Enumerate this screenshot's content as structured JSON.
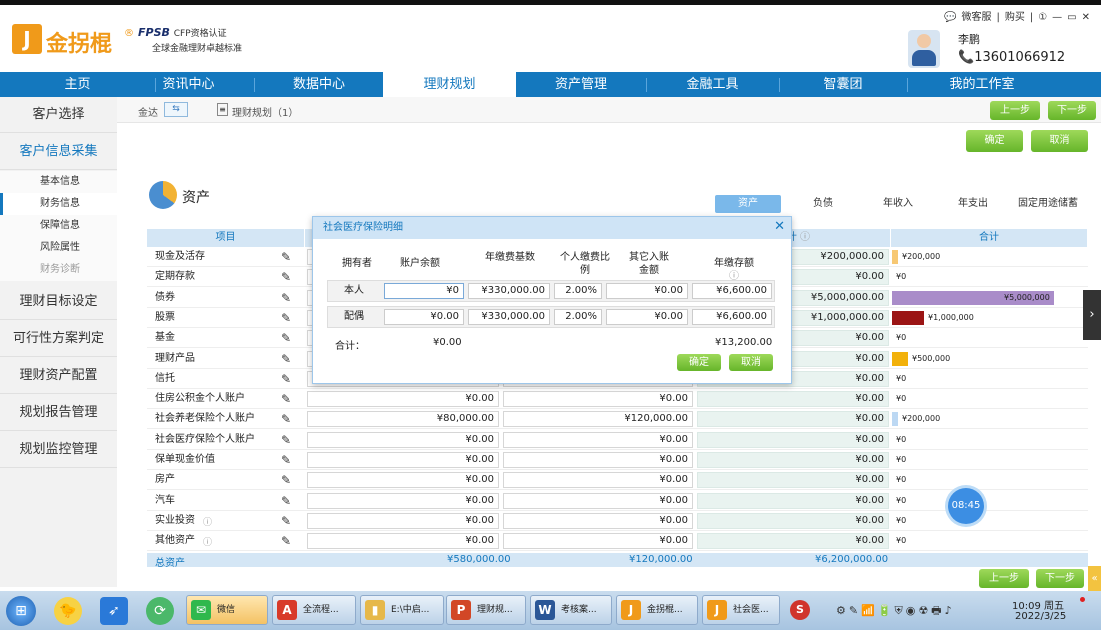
{
  "app": {
    "logo_text": "金拐棍",
    "logo_mark": "J",
    "logo_reg": "®",
    "fpsb_line1": "FPSB",
    "fpsb_sup": "CFP资格认证",
    "fpsb_line2": "全球金融理财卓越标准"
  },
  "window_controls": [
    "微客服",
    "购买",
    "①",
    "—",
    "▭",
    "✕"
  ],
  "user": {
    "name": "李鹏",
    "phone": "13601066912"
  },
  "nav": [
    "主页",
    "资讯中心",
    "数据中心",
    "理财规划",
    "资产管理",
    "金融工具",
    "智囊团",
    "我的工作室"
  ],
  "nav_active": "理财规划",
  "sidebar": {
    "main1": "客户选择",
    "main2": "客户信息采集",
    "subs": [
      "基本信息",
      "财务信息",
      "保障信息",
      "风险属性",
      "财务诊断"
    ],
    "mains": [
      "理财目标设定",
      "可行性方案判定",
      "理财资产配置",
      "规划报告管理",
      "规划监控管理"
    ]
  },
  "crumbs": {
    "client": "金达",
    "plan": "理财规划（1）"
  },
  "buttons": {
    "prev": "上一步",
    "next": "下一步",
    "confirm": "确定",
    "cancel": "取消"
  },
  "section_title": "资产",
  "tabs": [
    "资产",
    "负债",
    "年收入",
    "年支出",
    "固定用途储蓄"
  ],
  "table": {
    "headers": {
      "item": "项目",
      "col4": "计",
      "total": "合计"
    },
    "rows": [
      {
        "name": "现金及活存",
        "c1": "",
        "c2": "",
        "c3": "¥200,000.00",
        "bar_label": "¥200,000"
      },
      {
        "name": "定期存款",
        "c1": "",
        "c2": "",
        "c3": "¥0.00",
        "bar_label": "¥0"
      },
      {
        "name": "债券",
        "c1": "",
        "c2": "",
        "c3": "¥5,000,000.00",
        "bar_label": "¥5,000,000"
      },
      {
        "name": "股票",
        "c1": "",
        "c2": "",
        "c3": "¥1,000,000.00",
        "bar_label": "¥1,000,000"
      },
      {
        "name": "基金",
        "c1": "",
        "c2": "",
        "c3": "¥0.00",
        "bar_label": "¥0"
      },
      {
        "name": "理财产品",
        "c1": "",
        "c2": "",
        "c3": "¥0.00",
        "bar_label": "¥500,000"
      },
      {
        "name": "信托",
        "c1": "",
        "c2": "",
        "c3": "¥0.00",
        "bar_label": "¥0"
      },
      {
        "name": "住房公积金个人账户",
        "c1": "¥0.00",
        "c2": "¥0.00",
        "c3": "¥0.00",
        "bar_label": "¥0"
      },
      {
        "name": "社会养老保险个人账户",
        "c1": "¥80,000.00",
        "c2": "¥120,000.00",
        "c3": "¥0.00",
        "bar_label": "¥200,000"
      },
      {
        "name": "社会医疗保险个人账户",
        "c1": "¥0.00",
        "c2": "¥0.00",
        "c3": "¥0.00",
        "bar_label": "¥0"
      },
      {
        "name": "保单现金价值",
        "c1": "¥0.00",
        "c2": "¥0.00",
        "c3": "¥0.00",
        "bar_label": "¥0"
      },
      {
        "name": "房产",
        "c1": "¥0.00",
        "c2": "¥0.00",
        "c3": "¥0.00",
        "bar_label": "¥0"
      },
      {
        "name": "汽车",
        "c1": "¥0.00",
        "c2": "¥0.00",
        "c3": "¥0.00",
        "bar_label": "¥0"
      },
      {
        "name": "实业投资",
        "c1": "¥0.00",
        "c2": "¥0.00",
        "c3": "¥0.00",
        "bar_label": "¥0"
      },
      {
        "name": "其他资产",
        "c1": "¥0.00",
        "c2": "¥0.00",
        "c3": "¥0.00",
        "bar_label": "¥0"
      }
    ],
    "sum": {
      "name": "总资产",
      "c1": "¥580,000.00",
      "c2": "¥120,000.00",
      "c3": "¥6,200,000.00"
    },
    "bar_colors": {
      "cash": "#f7c873",
      "bond": "#a98cc9",
      "stock": "#9b1515",
      "product": "#f2b10a",
      "pension": "#bcd8f3"
    }
  },
  "dialog": {
    "title": "社会医疗保险明细",
    "headers": [
      "拥有者",
      "账户余额",
      "年缴费基数",
      "个人缴费比例",
      "其它入账金额",
      "年缴存额"
    ],
    "rows": [
      {
        "owner": "本人",
        "balance": "¥0",
        "base": "¥330,000.00",
        "ratio": "2.00%",
        "other": "¥0.00",
        "annual": "¥6,600.00"
      },
      {
        "owner": "配偶",
        "balance": "¥0.00",
        "base": "¥330,000.00",
        "ratio": "2.00%",
        "other": "¥0.00",
        "annual": "¥6,600.00"
      }
    ],
    "total_label": "合计：",
    "total_balance": "¥0.00",
    "total_annual": "¥13,200.00"
  },
  "timer": "08:45",
  "taskbar": {
    "apps": [
      "微信",
      "全流程...",
      "E:\\中启...",
      "理财规...",
      "考核案...",
      "金拐棍...",
      "社会医..."
    ],
    "time": "10:09 周五",
    "date": "2022/3/25"
  }
}
